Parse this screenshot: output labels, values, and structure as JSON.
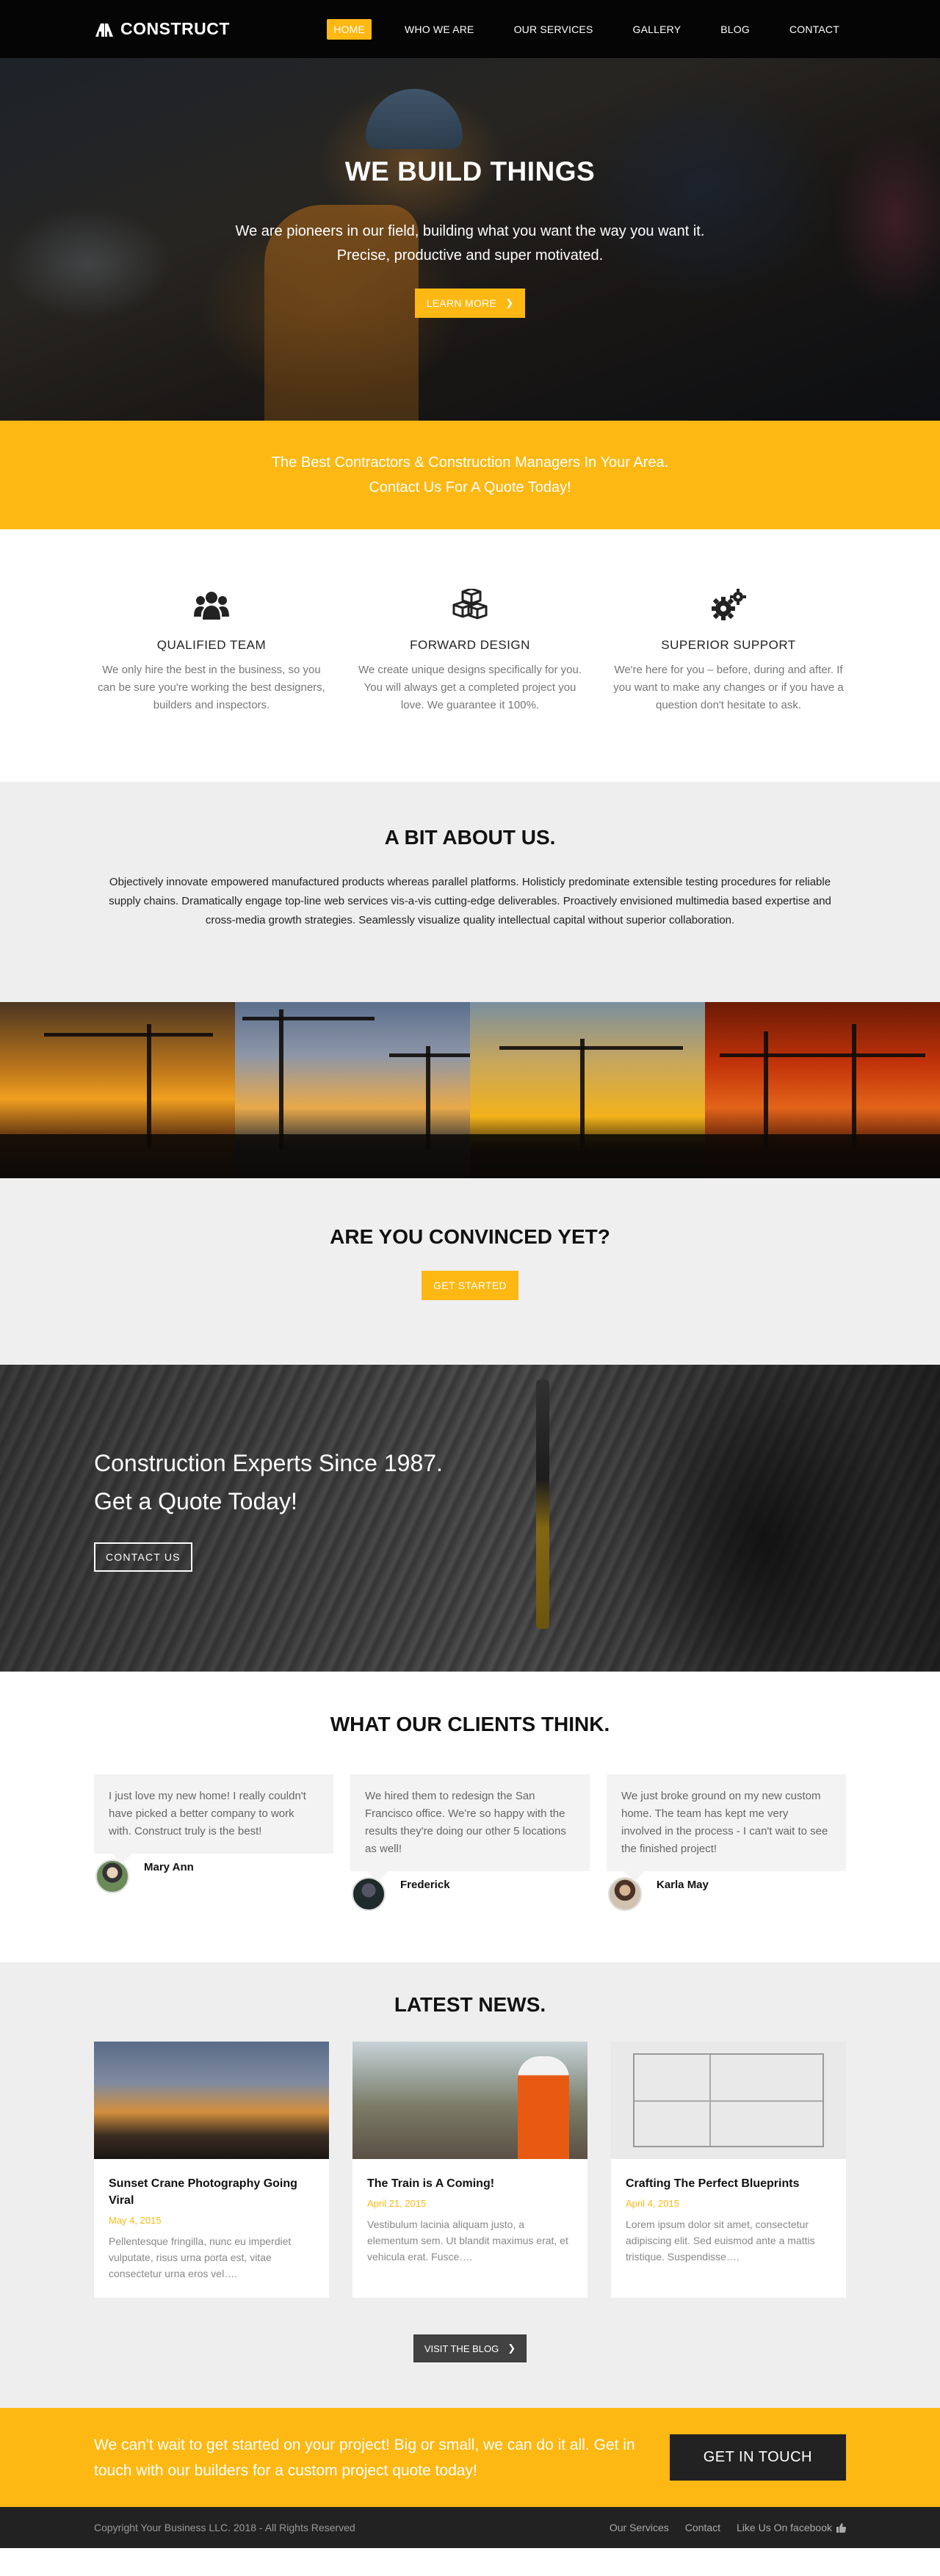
{
  "nav": {
    "brand": "CONSTRUCT",
    "items": [
      {
        "label": "HOME",
        "active": true
      },
      {
        "label": "WHO WE ARE"
      },
      {
        "label": "OUR SERVICES"
      },
      {
        "label": "GALLERY"
      },
      {
        "label": "BLOG"
      },
      {
        "label": "CONTACT"
      }
    ]
  },
  "hero": {
    "title": "WE BUILD THINGS",
    "line1": "We are pioneers in our field, building what you want the way you want it.",
    "line2": "Precise, productive and super motivated.",
    "button": "LEARN MORE"
  },
  "strip": {
    "line1": "The Best Contractors & Construction Managers In Your Area.",
    "line2": "Contact Us For A Quote Today!"
  },
  "features": [
    {
      "icon": "users-icon",
      "title": "QUALIFIED TEAM",
      "text": "We only hire the best in the business, so you can be sure you're working the best designers, builders and inspectors."
    },
    {
      "icon": "cubes-icon",
      "title": "FORWARD DESIGN",
      "text": "We create unique designs specifically for you. You will always get a completed project you love. We guarantee it 100%."
    },
    {
      "icon": "gears-icon",
      "title": "SUPERIOR SUPPORT",
      "text": "We're here for you – before, during and after. If you want to make any changes or if you have a question don't hesitate to ask."
    }
  ],
  "about": {
    "title": "A BIT ABOUT US.",
    "text": "Objectively innovate empowered manufactured products whereas parallel platforms. Holisticly predominate extensible testing procedures for reliable supply chains. Dramatically engage top-line web services vis-a-vis cutting-edge deliverables. Proactively envisioned multimedia based expertise and cross-media growth strategies. Seamlessly visualize quality intellectual capital without superior collaboration."
  },
  "convinced": {
    "title": "ARE YOU CONVINCED YET?",
    "button": "GET STARTED"
  },
  "banner": {
    "line1": "Construction Experts Since 1987.",
    "line2": "Get a Quote Today!",
    "button": "CONTACT US"
  },
  "testimonials": {
    "title": "WHAT OUR CLIENTS THINK.",
    "items": [
      {
        "text": "I just love my new home! I really couldn't have picked a better company to work with. Construct truly is the best!",
        "name": "Mary Ann"
      },
      {
        "text": "We hired them to redesign the San Francisco office. We're so happy with the results they're doing our other 5 locations as well!",
        "name": "Frederick"
      },
      {
        "text": "We just broke ground on my new custom home. The team has kept me very involved in the process - I can't wait to see the finished project!",
        "name": "Karla May"
      }
    ]
  },
  "news": {
    "title": "LATEST NEWS.",
    "items": [
      {
        "title": "Sunset Crane Photography Going Viral",
        "date": "May 4, 2015",
        "excerpt": "Pellentesque fringilla, nunc eu imperdiet vulputate, risus urna porta est, vitae consectetur urna eros vel…."
      },
      {
        "title": "The Train is A Coming!",
        "date": "April 21, 2015",
        "excerpt": "Vestibulum lacinia aliquam justo, a elementum sem. Ut blandit maximus erat, et vehicula erat. Fusce…."
      },
      {
        "title": "Crafting The Perfect Blueprints",
        "date": "April 4, 2015",
        "excerpt": "Lorem ipsum dolor sit amet, consectetur adipiscing elit. Sed euismod ante a mattis tristique. Suspendisse…."
      }
    ],
    "button": "VISIT THE BLOG"
  },
  "footer_cta": {
    "text": "We can't wait to get started on your project! Big or small, we can do it all. Get in touch with our builders for a custom project quote today!",
    "button": "GET IN TOUCH"
  },
  "footer": {
    "copyright": "Copyright Your Business LLC. 2018 - All Rights Reserved",
    "links": [
      "Our Services",
      "Contact",
      "Like Us On facebook"
    ]
  },
  "colors": {
    "accent": "#fdb813",
    "dark": "#050505",
    "light_bg": "#eeeeee"
  }
}
